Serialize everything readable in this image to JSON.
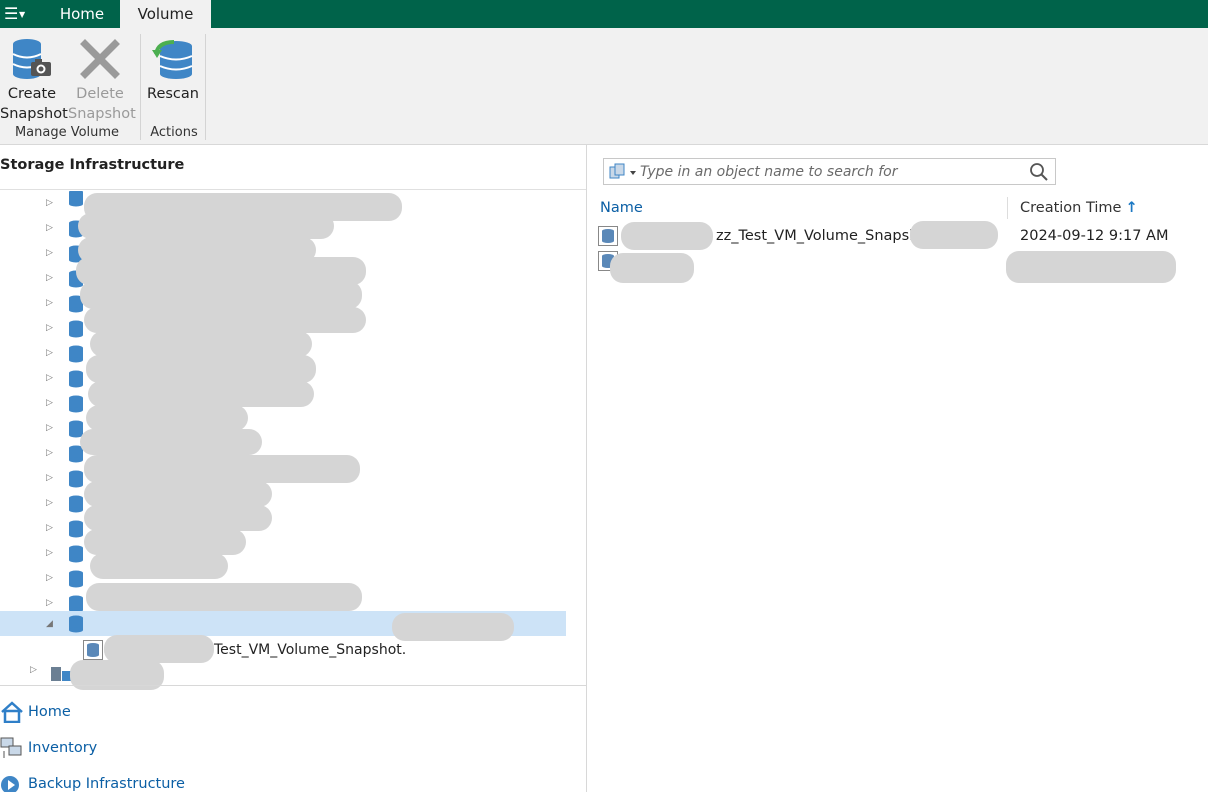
{
  "tabs": {
    "home": "Home",
    "volume": "Volume"
  },
  "ribbon": {
    "create_snapshot": [
      "Create",
      "Snapshot"
    ],
    "delete_snapshot": [
      "Delete",
      "Snapshot"
    ],
    "rescan": "Rescan",
    "group_manage": "Manage Volume",
    "group_actions": "Actions"
  },
  "left_panel": {
    "title": "Storage Infrastructure",
    "snapshot_item_1_visible": "Test_VM_Volume_Snapshot.",
    "nav": {
      "home": "Home",
      "inventory": "Inventory",
      "backup_infrastructure": "Backup Infrastructure"
    }
  },
  "right_panel": {
    "search_placeholder": "Type in an object name to search for",
    "columns": {
      "name": "Name",
      "creation_time": "Creation Time"
    },
    "rows": [
      {
        "name_visible": "zz_Test_VM_Volume_Snapsho",
        "creation_time": "2024-09-12 9:17 AM"
      },
      {
        "name_visible": "",
        "creation_time": ""
      }
    ]
  },
  "colors": {
    "brand_green": "#00634a",
    "ribbon_bg": "#f1f1f1",
    "link_blue": "#0b5fa5",
    "selected_row": "#cde3f7"
  }
}
